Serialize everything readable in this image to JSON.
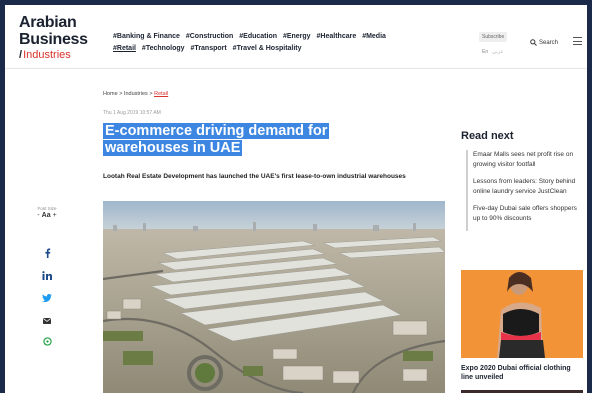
{
  "logo": {
    "line1": "Arabian",
    "line2": "Business",
    "slash": "/",
    "line3": "Industries"
  },
  "header": {
    "tags": [
      {
        "label": "#Banking & Finance"
      },
      {
        "label": "#Construction"
      },
      {
        "label": "#Education"
      },
      {
        "label": "#Energy"
      },
      {
        "label": "#Healthcare"
      },
      {
        "label": "#Media"
      },
      {
        "label": "#Retail"
      },
      {
        "label": "#Technology"
      },
      {
        "label": "#Transport"
      },
      {
        "label": "#Travel & Hospitality"
      }
    ],
    "subscribe_label": "Subscribe",
    "lang_en": "En",
    "lang_ar": "عربي",
    "search_label": "Search"
  },
  "breadcrumb": {
    "home": "Home",
    "sep1": " > ",
    "industries": "Industries",
    "sep2": " > ",
    "retail": "Retail"
  },
  "article": {
    "date": "Thu 1 Aug 2019 10:57 AM",
    "title": "E-commerce driving demand for warehouses in UAE",
    "lead": "Lootah Real Estate Development has launched the UAE's first lease-to-own industrial warehouses"
  },
  "font_size": {
    "label": "Font Size",
    "minus": "-",
    "aa": "Aa",
    "plus": "+"
  },
  "share_icons": [
    "facebook-icon",
    "linkedin-icon",
    "twitter-icon",
    "email-icon",
    "whatsapp-icon"
  ],
  "sidebar": {
    "read_next_title": "Read next",
    "items": [
      {
        "text": "Emaar Malls sees net profit rise on growing visitor footfall"
      },
      {
        "text": "Lessons from leaders: Story behind online laundry service JustClean"
      },
      {
        "text": "Five-day Dubai sale offers shoppers up to 90% discounts"
      }
    ],
    "promo_caption": "Expo 2020 Dubai official clothing line unveiled"
  },
  "colors": {
    "highlight": "#3d86e2",
    "accent": "#d9312b",
    "brand_dark": "#1b2230",
    "outer_bg": "#1c2a4a"
  }
}
